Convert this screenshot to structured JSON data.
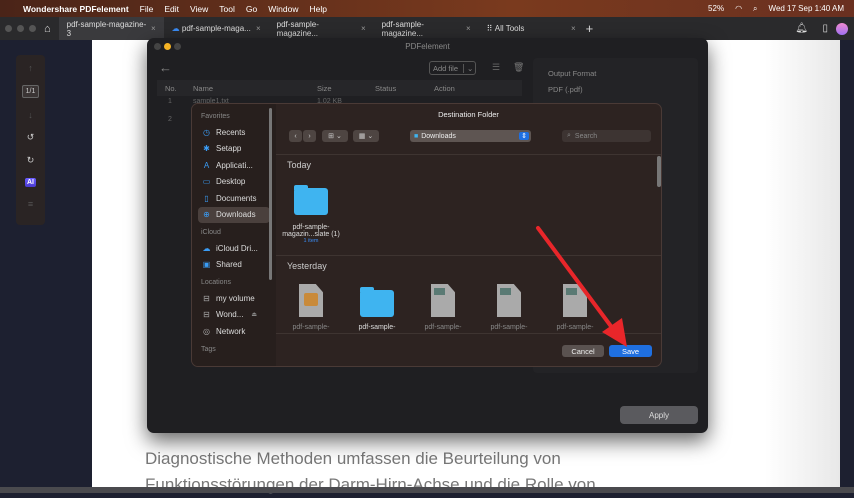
{
  "menubar": {
    "app": "Wondershare PDFelement",
    "items": [
      "File",
      "Edit",
      "View",
      "Tool",
      "Go",
      "Window",
      "Help"
    ],
    "battery": "52%",
    "datetime": "Wed 17 Sep  1:40 AM"
  },
  "tabs": [
    {
      "label": "pdf-sample-magazine-3"
    },
    {
      "label": "pdf-sample-maga..."
    },
    {
      "label": "pdf-sample-magazine..."
    },
    {
      "label": "pdf-sample-magazine..."
    },
    {
      "label": "All Tools"
    }
  ],
  "toolbar": {
    "page": "1/1",
    "ai": "AI"
  },
  "document": {
    "line1": "Diagnostische Methoden umfassen die Beurteilung von",
    "line2": "Funktionsstörungen der Darm-Hirn-Achse und die Rolle von"
  },
  "window": {
    "title": "PDFelement",
    "add_file": "Add file",
    "columns": [
      "No.",
      "Name",
      "Size",
      "Status",
      "Action"
    ],
    "rows": [
      {
        "no": "1",
        "name": "sample1.txt",
        "size": "1.02 KB"
      },
      {
        "no": "2"
      }
    ],
    "output_format_label": "Output Format",
    "output_format_value": "PDF (.pdf)",
    "apply": "Apply"
  },
  "dialog": {
    "title": "Destination Folder",
    "location": "Downloads",
    "search_placeholder": "Search",
    "sidebar": {
      "favorites_label": "Favorites",
      "favorites": [
        "Recents",
        "Setapp",
        "Applicati...",
        "Desktop",
        "Documents",
        "Downloads"
      ],
      "icloud_label": "iCloud",
      "icloud": [
        "iCloud Dri...",
        "Shared"
      ],
      "locations_label": "Locations",
      "locations": [
        "my volume",
        "Wond...",
        "Network"
      ],
      "tags_label": "Tags"
    },
    "today_label": "Today",
    "today_files": [
      {
        "name1": "pdf-sample-",
        "name2": "magazin...slate (1)",
        "sub": "1 item"
      }
    ],
    "yesterday_label": "Yesterday",
    "yesterday_files": [
      "pdf-sample-",
      "pdf-sample-",
      "pdf-sample-",
      "pdf-sample-",
      "pdf-sample-"
    ],
    "cancel": "Cancel",
    "save": "Save"
  },
  "colors": {
    "accent": "#1f6fe0",
    "arrow": "#e8262a",
    "folder": "#3fb4f0"
  }
}
